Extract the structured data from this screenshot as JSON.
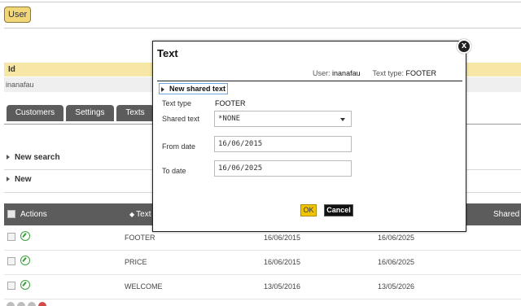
{
  "header": {
    "user_button": "User"
  },
  "details": {
    "id_label": "Id",
    "id_value": "inanafau"
  },
  "tabs": [
    {
      "label": "Customers"
    },
    {
      "label": "Settings"
    },
    {
      "label": "Texts",
      "active": true
    }
  ],
  "sections": {
    "new_search": "New search",
    "new": "New"
  },
  "table": {
    "columns": {
      "actions": "Actions",
      "text": "Text",
      "shared": "Shared"
    },
    "rows": [
      {
        "text": "FOOTER",
        "from": "16/06/2015",
        "to": "16/06/2025"
      },
      {
        "text": "PRICE",
        "from": "16/06/2015",
        "to": "16/06/2025"
      },
      {
        "text": "WELCOME",
        "from": "13/05/2016",
        "to": "13/05/2026"
      }
    ]
  },
  "modal": {
    "title": "Text",
    "close_glyph": "x",
    "user_label": "User:",
    "user_value": "inanafau",
    "text_type_label": "Text type:",
    "text_type_value": "FOOTER",
    "new_shared_text": "New shared text",
    "form": {
      "text_type_label": "Text type",
      "text_type_value": "FOOTER",
      "shared_text_label": "Shared text",
      "shared_text_value": "*NONE",
      "from_date_label": "From date",
      "from_date_value": "16/06/2015",
      "to_date_label": "To date",
      "to_date_value": "16/06/2025"
    },
    "ok_label": "OK",
    "cancel_label": "Cancel"
  },
  "colors": {
    "user_button": "#f2d779",
    "tab_bg": "#5c5c5c",
    "id_header_bg": "#f7e7a6",
    "ok_button": "#f2c400",
    "cancel_button": "#111111",
    "edit_icon": "#3aa13a"
  }
}
